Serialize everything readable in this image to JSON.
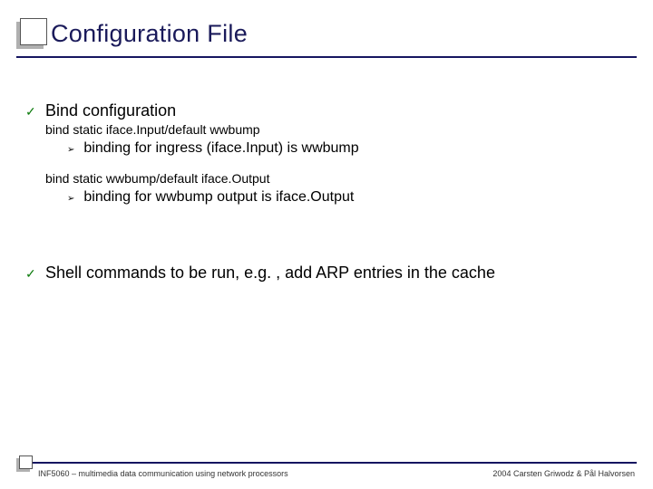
{
  "title": "Configuration File",
  "bullets": {
    "b1": "Bind configuration",
    "cfg1": "bind static iface.Input/default wwbump",
    "sub1": "binding for ingress (iface.Input) is wwbump",
    "cfg2": "bind static wwbump/default iface.Output",
    "sub2": "binding for wwbump output is iface.Output",
    "b2": "Shell commands to be run, e.g. , add ARP entries in the cache"
  },
  "footer": {
    "left": "INF5060 – multimedia data communication using network processors",
    "right": "2004  Carsten Griwodz & Pål Halvorsen"
  }
}
